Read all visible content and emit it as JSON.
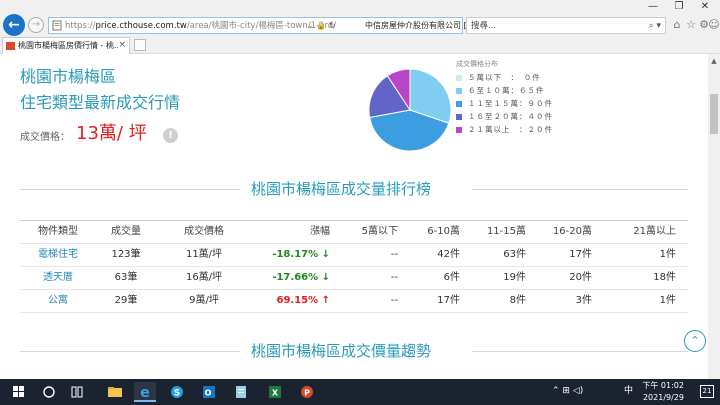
{
  "browser": {
    "url_prefix": "https://",
    "url_domain": "price.cthouse.com.tw",
    "url_path": "/area/桃園市-city/楊梅區-town/1-ord/",
    "url_controls": "⌄ 🔒 ↻",
    "site_identity": "中信房屋仲介股份有限公司 [...",
    "search_placeholder": "搜尋...",
    "tab_title": "桃園市楊梅區房價行情 - 桃...",
    "tab_close": "×",
    "back": "←",
    "forward": "→",
    "window_minimize": "—",
    "window_maximize": "❐",
    "window_close": "✕",
    "toolbar_home": "⌂",
    "toolbar_favorites": "☆",
    "toolbar_settings": "⚙",
    "toolbar_smiley": "☺"
  },
  "header": {
    "area": "桃園市楊梅區",
    "subtitle": "住宅類型最新成交行情",
    "price_label": "成交價格：",
    "price_value": "13萬/ 坪",
    "info": "!"
  },
  "pie": {
    "legend_title": "成交價格分布",
    "items": [
      {
        "label": "５萬以下　：　０件",
        "value": 0,
        "color": "#c9ece4"
      },
      {
        "label": "６至１０萬：６５件",
        "value": 65,
        "color": "#7fcdf0"
      },
      {
        "label": "１１至１５萬：９０件",
        "value": 90,
        "color": "#3c9de0"
      },
      {
        "label": "１６至２０萬：４０件",
        "value": 40,
        "color": "#6264c8"
      },
      {
        "label": "２１萬以上　：２０件",
        "value": 20,
        "color": "#b946c8"
      }
    ]
  },
  "ranking": {
    "title": "桃園市楊梅區成交量排行榜",
    "headers": [
      "物件類型",
      "成交量",
      "成交價格",
      "漲幅",
      "5萬以下",
      "6-10萬",
      "11-15萬",
      "16-20萬",
      "21萬以上"
    ],
    "rows": [
      {
        "type": "電梯住宅",
        "volume": "123筆",
        "price": "11萬/坪",
        "change": "-18.17% ↓",
        "dir": "neg",
        "b1": "--",
        "b2": "42件",
        "b3": "63件",
        "b4": "17件",
        "b5": "1件"
      },
      {
        "type": "透天厝",
        "volume": "63筆",
        "price": "16萬/坪",
        "change": "-17.66% ↓",
        "dir": "neg",
        "b1": "--",
        "b2": "6件",
        "b3": "19件",
        "b4": "20件",
        "b5": "18件"
      },
      {
        "type": "公寓",
        "volume": "29筆",
        "price": "9萬/坪",
        "change": "69.15% ↑",
        "dir": "pos",
        "b1": "--",
        "b2": "17件",
        "b3": "8件",
        "b4": "3件",
        "b5": "1件"
      }
    ]
  },
  "trend": {
    "title": "桃園市楊梅區成交價量趨勢"
  },
  "scroll_top": "⌃",
  "taskbar": {
    "time": "下午 01:02",
    "date": "2021/9/29",
    "ime": "中",
    "notifications": "21",
    "tray_icons": "⌃ ⊞ ◁)"
  }
}
